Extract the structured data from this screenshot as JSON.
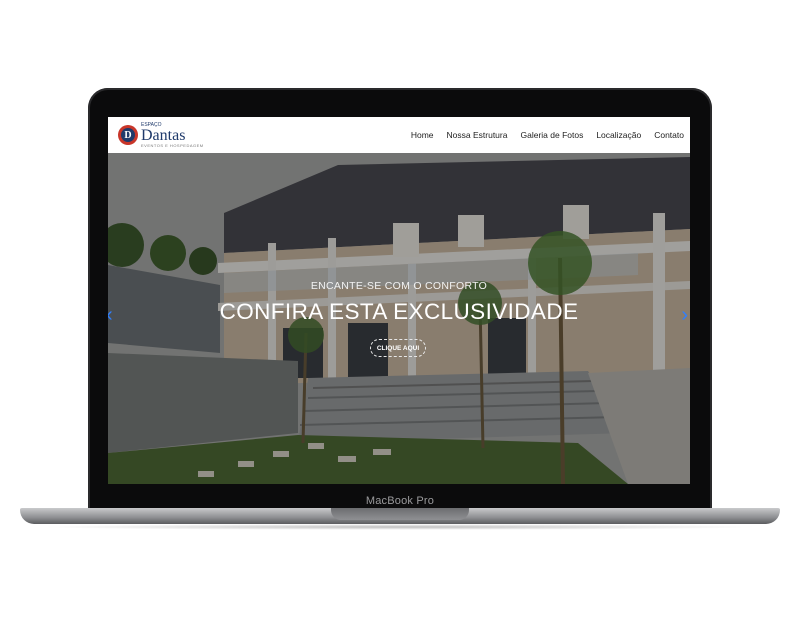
{
  "device": {
    "model_label": "MacBook Pro"
  },
  "site": {
    "logo": {
      "small_text": "ESPAÇO",
      "name": "Dantas",
      "tagline": "EVENTOS E HOSPEDAGEM",
      "mark_letter": "D"
    },
    "nav": [
      {
        "label": "Home"
      },
      {
        "label": "Nossa Estrutura"
      },
      {
        "label": "Galeria de Fotos"
      },
      {
        "label": "Localização"
      },
      {
        "label": "Contato"
      }
    ],
    "hero": {
      "subtitle": "ENCANTE-SE COM O CONFORTO",
      "title": "CONFIRA ESTA EXCLUSIVIDADE",
      "button_label": "CLIQUE AQUI",
      "prev_arrow": "‹",
      "next_arrow": "›"
    }
  },
  "colors": {
    "accent_arrow": "#2f7fff",
    "brand_navy": "#1f3a6b",
    "brand_red": "#c8362a"
  }
}
